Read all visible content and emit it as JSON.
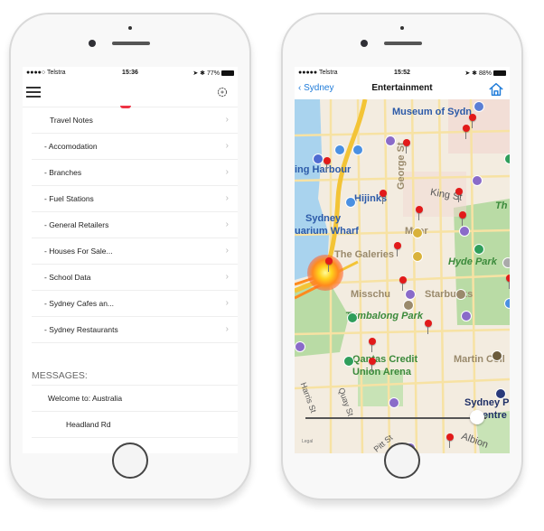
{
  "left_phone": {
    "status": {
      "carrier": "●●●●○ Telstra",
      "wifi": "wifi-icon",
      "time": "15:36",
      "right": "➤ ✱ 77%"
    },
    "topbar": {
      "menu_icon": "hamburger-icon",
      "settings_icon": "gear-icon"
    },
    "menu_items": [
      {
        "label": "Travel Notes"
      },
      {
        "label": "- Accomodation"
      },
      {
        "label": "- Branches"
      },
      {
        "label": "- Fuel Stations"
      },
      {
        "label": "- General Retailers"
      },
      {
        "label": "- Houses For Sale..."
      },
      {
        "label": "- School Data"
      },
      {
        "label": "- Sydney Cafes an..."
      },
      {
        "label": "- Sydney Restaurants"
      }
    ],
    "chevron": "›",
    "messages_header": "MESSAGES:",
    "messages": [
      {
        "text": "Welcome to: Australia"
      },
      {
        "text": "Headland Rd"
      }
    ]
  },
  "right_phone": {
    "status": {
      "carrier": "●●●●● Telstra",
      "wifi": "wifi-icon",
      "time": "15:52",
      "right": "➤ ✱ 88%"
    },
    "navbar": {
      "back_label": "‹ Sydney",
      "title": "Entertainment",
      "home_icon": "home-icon"
    },
    "map": {
      "labels": {
        "museum": "Museum of Sydn",
        "harbour": "ing Harbour",
        "hijinks": "Hijinks",
        "george_st": "George St",
        "king_st": "King St",
        "sydney": "Sydney",
        "aquarium": "uarium Wharf",
        "myer": "Myer",
        "the_galeries": "The Galeries",
        "hyde_park": "Hyde Park",
        "misschu": "Misschu",
        "starbucks": "Starbucks",
        "tumbalong": "Tumbalong Park",
        "qantas": "Qantas Credit",
        "union_arena": "Union Arena",
        "martin": "Martin Coll",
        "harris_st": "Harris St",
        "quay_st": "Quay St",
        "sydney_po": "Sydney Po",
        "centre": "Centre",
        "pitt_st": "Pitt St",
        "albion": "Albion",
        "the": "Th",
        "legal": "Legal"
      },
      "slider_value_fraction": 0.95
    },
    "colors": {
      "accent": "#1e7bd9",
      "pin": "#e21a1a",
      "park": "#b9dba5",
      "water": "#a9d3ee",
      "road": "#f7d774"
    }
  }
}
